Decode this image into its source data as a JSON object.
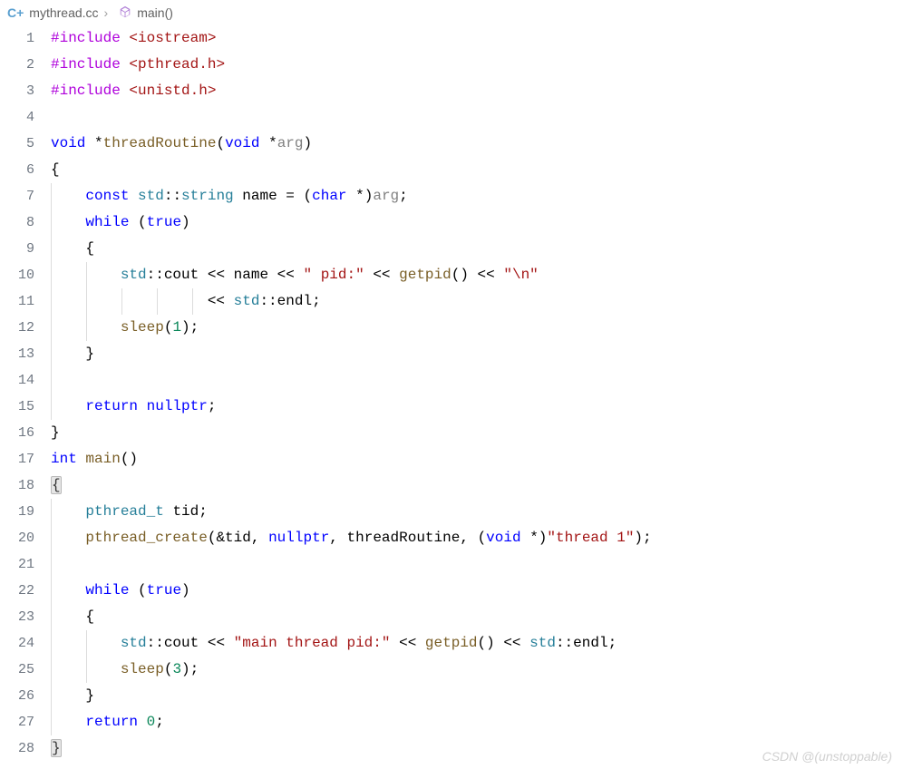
{
  "breadcrumb": {
    "file": "mythread.cc",
    "symbol": "main()"
  },
  "line_count": 28,
  "code": {
    "includes": [
      {
        "directive": "#include",
        "file": "<iostream>"
      },
      {
        "directive": "#include",
        "file": "<pthread.h>"
      },
      {
        "directive": "#include",
        "file": "<unistd.h>"
      }
    ],
    "func1": {
      "ret": "void",
      "star": "*",
      "name": "threadRoutine",
      "paramtype": "void",
      "paramstar": "*",
      "paramname": "arg"
    },
    "line7": {
      "const": "const",
      "std": "std",
      "sep": "::",
      "string": "string",
      "var": "name",
      "eq": "=",
      "lparen": "(",
      "char": "char",
      "star": "*",
      "rparen": ")",
      "arg": "arg",
      "semi": ";"
    },
    "line8": {
      "while": "while",
      "lparen": "(",
      "true": "true",
      "rparen": ")"
    },
    "line10": {
      "std": "std",
      "sep": "::",
      "cout": "cout",
      "op": "<<",
      "name": "name",
      "str1": "\" pid:\"",
      "getpid": "getpid",
      "parens": "()",
      "str2": "\"\\n\""
    },
    "line11": {
      "op": "<<",
      "std": "std",
      "sep": "::",
      "endl": "endl",
      "semi": ";"
    },
    "line12": {
      "sleep": "sleep",
      "lparen": "(",
      "num": "1",
      "rparen": ")",
      "semi": ";"
    },
    "line15": {
      "return": "return",
      "nullptr": "nullptr",
      "semi": ";"
    },
    "line17": {
      "int": "int",
      "main": "main",
      "parens": "()"
    },
    "line19": {
      "type": "pthread_t",
      "var": "tid",
      "semi": ";"
    },
    "line20": {
      "fn": "pthread_create",
      "lparen": "(",
      "amp": "&",
      "tid": "tid",
      "comma": ",",
      "nullptr": "nullptr",
      "routine": "threadRoutine",
      "void": "void",
      "star": "*",
      "rparen": ")",
      "str": "\"thread 1\"",
      "semi": ";"
    },
    "line22": {
      "while": "while",
      "lparen": "(",
      "true": "true",
      "rparen": ")"
    },
    "line24": {
      "std": "std",
      "sep": "::",
      "cout": "cout",
      "op": "<<",
      "str": "\"main thread pid:\"",
      "getpid": "getpid",
      "parens": "()",
      "endl": "endl",
      "semi": ";"
    },
    "line25": {
      "sleep": "sleep",
      "lparen": "(",
      "num": "3",
      "rparen": ")",
      "semi": ";"
    },
    "line27": {
      "return": "return",
      "num": "0",
      "semi": ";"
    },
    "brace_open": "{",
    "brace_close": "}"
  },
  "watermark": "CSDN @(unstoppable)"
}
